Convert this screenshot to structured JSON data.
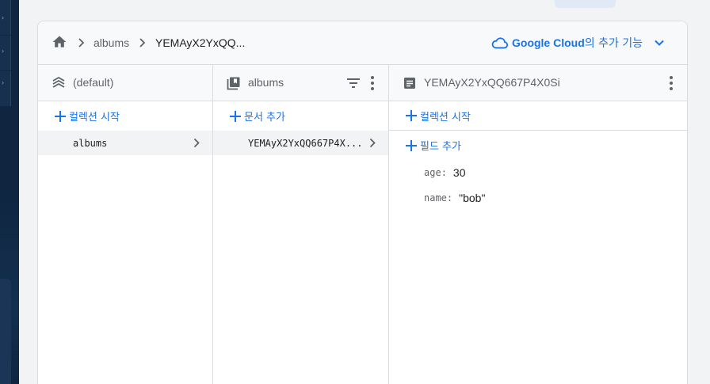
{
  "breadcrumb": {
    "collection": "albums",
    "document": "YEMAyX2YxQQ..."
  },
  "google_cloud": {
    "brand": "Google Cloud",
    "suffix": "의 추가 기능"
  },
  "columns": {
    "root": {
      "title": "(default)",
      "action_label": "컬렉션 시작",
      "items": [
        "albums"
      ]
    },
    "collection": {
      "title": "albums",
      "action_label": "문서 추가",
      "items": [
        "YEMAyX2YxQQ667P4X..."
      ]
    },
    "document": {
      "title": "YEMAyX2YxQQ667P4X0Si",
      "start_collection_label": "컬렉션 시작",
      "add_field_label": "필드 추가",
      "fields": [
        {
          "key": "age",
          "value": "30"
        },
        {
          "key": "name",
          "value": "\"bob\""
        }
      ]
    }
  },
  "colors": {
    "accent": "#1a73e8",
    "text": "#202124",
    "muted": "#5f6368",
    "border": "#dadce0"
  },
  "icons": {
    "home": "home-icon",
    "database": "database-layers-icon",
    "collection": "collection-icon",
    "document": "document-icon",
    "filter": "filter-icon",
    "more": "more-vert-icon",
    "add": "plus-icon",
    "cloud": "cloud-icon"
  }
}
